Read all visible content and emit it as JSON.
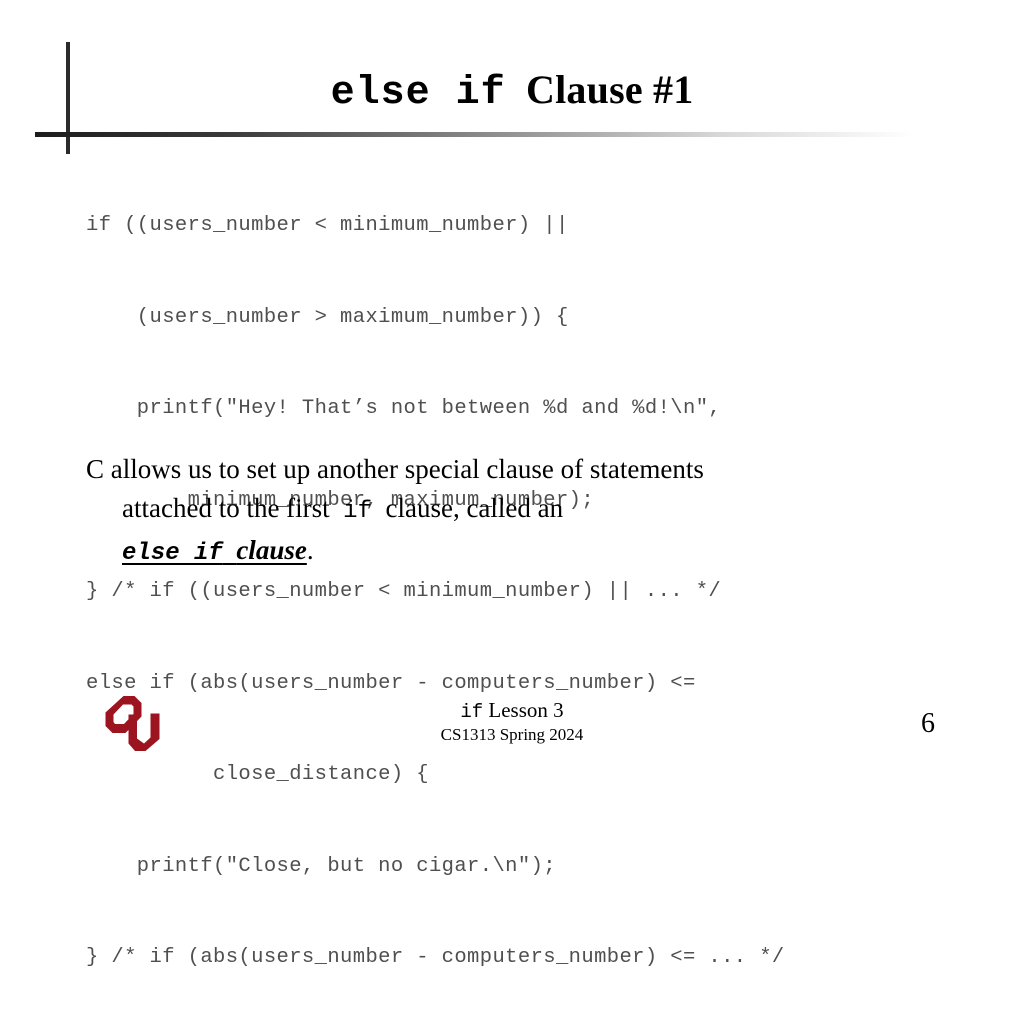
{
  "slide": {
    "title": {
      "mono_part": "else if",
      "serif_part": "Clause #1",
      "full": "else if Clause #1"
    },
    "code": {
      "language": "c",
      "lines": [
        "if ((users_number < minimum_number) ||",
        "    (users_number > maximum_number)) {",
        "    printf(\"Hey! That’s not between %d and %d!\\n\",",
        "        minimum_number, maximum_number);",
        "} /* if ((users_number < minimum_number) || ... */",
        "else if (abs(users_number - computers_number) <=",
        "          close_distance) {",
        "    printf(\"Close, but no cigar.\\n\");",
        "} /* if (abs(users_number - computers_number) <= ... */"
      ]
    },
    "body": {
      "line1": "C allows us to set up another special clause of statements",
      "line2_a": "attached to the first",
      "line2_mono": "if",
      "line2_b": "clause, called an",
      "term_mono": "else if",
      "term_serif": "clause",
      "term_period": "."
    },
    "footer": {
      "lesson_mono": "if",
      "lesson_serif": "Lesson 3",
      "course": "CS1313 Spring 2024",
      "page_number": "6"
    },
    "logo": {
      "name": "ou-logo",
      "alt": "OU",
      "color": "#9C1420"
    },
    "colors": {
      "background": "#FFFFFF",
      "title_text": "#000000",
      "code_text": "#4F4F4F",
      "body_text": "#000000",
      "rule_dark": "#1C1C1C",
      "crimson": "#9C1420"
    }
  }
}
